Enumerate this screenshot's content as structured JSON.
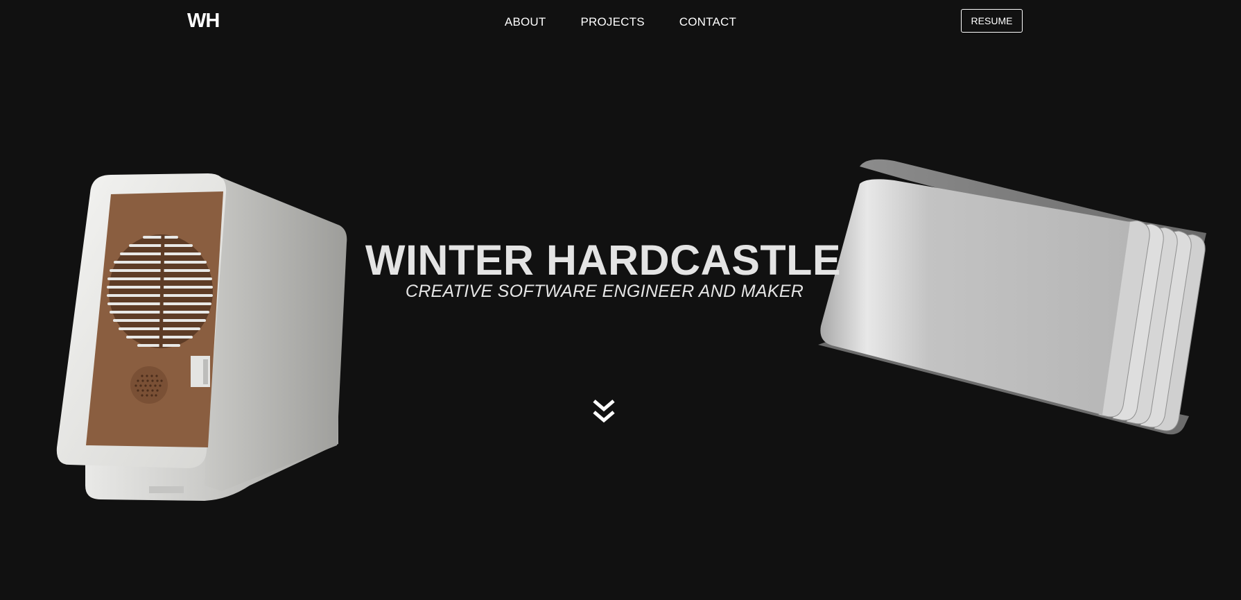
{
  "header": {
    "logo": "WH",
    "nav": [
      {
        "label": "ABOUT"
      },
      {
        "label": "PROJECTS"
      },
      {
        "label": "CONTACT"
      }
    ],
    "resume_label": "RESUME"
  },
  "hero": {
    "title": "WINTER HARDCASTLE",
    "subtitle": "CREATIVE SOFTWARE ENGINEER AND MAKER",
    "scroll_icon": "double-chevron-down-icon"
  },
  "colors": {
    "background": "#111111",
    "text": "#ffffff",
    "accent_wood": "#8a5e40",
    "device_body": "#c8c8c8"
  }
}
